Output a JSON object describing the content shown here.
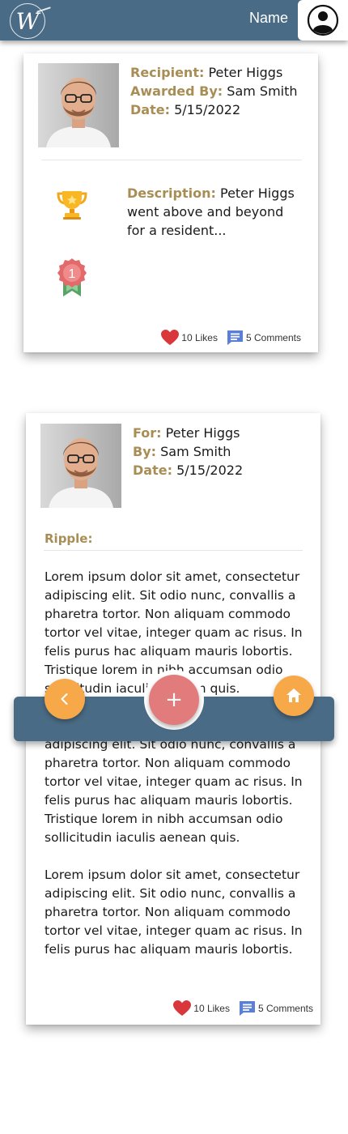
{
  "header": {
    "logo_letter": "W",
    "user_name": "Name"
  },
  "award_card": {
    "recipient_label": "Recipient:",
    "recipient": "Peter Higgs",
    "awarded_by_label": "Awarded By:",
    "awarded_by": "Sam Smith",
    "date_label": "Date:",
    "date": "5/15/2022",
    "description_label": "Description:",
    "description": "Peter Higgs went above and beyond for a resident...",
    "medal_number": "1",
    "likes": "10 Likes",
    "comments": "5 Comments"
  },
  "ripple_card": {
    "for_label": "For:",
    "for": "Peter Higgs",
    "by_label": "By:",
    "by": "Sam Smith",
    "date_label": "Date:",
    "date": "5/15/2022",
    "ripple_label": "Ripple:",
    "body": "Lorem ipsum dolor sit amet, consectetur adipiscing elit. Sit odio nunc, convallis a pharetra tortor. Non aliquam commodo tortor vel vitae, integer quam ac risus. In felis purus hac aliquam mauris lobortis. Tristique lorem in nibh accumsan odio sollicitudin iaculis aenean quis.\n\nLorem ipsum dolor sit amet, consectetur adipiscing elit. Sit odio nunc, convallis a pharetra tortor. Non aliquam commodo tortor vel vitae, integer quam ac risus. In felis purus hac aliquam mauris lobortis. Tristique lorem in nibh accumsan odio sollicitudin iaculis aenean quis.\n\nLorem ipsum dolor sit amet, consectetur adipiscing elit. Sit odio nunc, convallis a pharetra tortor. Non aliquam commodo tortor vel vitae, integer quam ac risus. In felis purus hac aliquam mauris lobortis.",
    "likes": "10 Likes",
    "comments": "5 Comments"
  },
  "nav": {
    "add_label": "+"
  },
  "colors": {
    "header": "#4a6b85",
    "label_gold": "#a88e55",
    "fab": "#e27c7c",
    "nav_button": "#f7a94a",
    "heart": "#d8383c",
    "comment": "#5b7fd6"
  }
}
